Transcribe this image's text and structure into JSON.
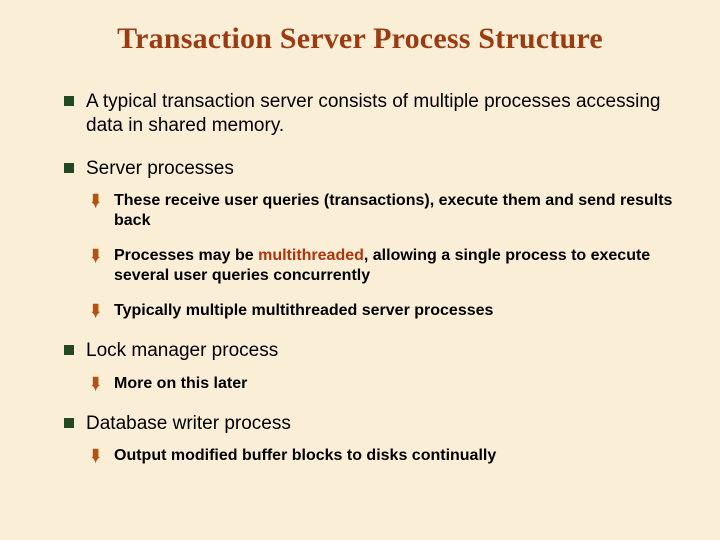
{
  "title": "Transaction Server Process Structure",
  "b1": "A typical transaction server consists of multiple processes accessing data in shared memory.",
  "b2": "Server processes",
  "b2s": {
    "a": "These receive user queries (transactions), execute them and send results back",
    "b_pre": "Processes may be ",
    "b_hl": "multithreaded",
    "b_post": ", allowing a single process to execute several user queries concurrently",
    "c": "Typically multiple multithreaded server processes"
  },
  "b3": "Lock manager process",
  "b3s": {
    "a": "More on this later"
  },
  "b4": "Database writer process",
  "b4s": {
    "a": "Output modified buffer blocks to disks continually"
  },
  "colors": {
    "bg": "#fbeed7",
    "title": "#9b3b12",
    "square": "#214a24",
    "arrow": "#b3530f",
    "highlight": "#b3320a"
  }
}
